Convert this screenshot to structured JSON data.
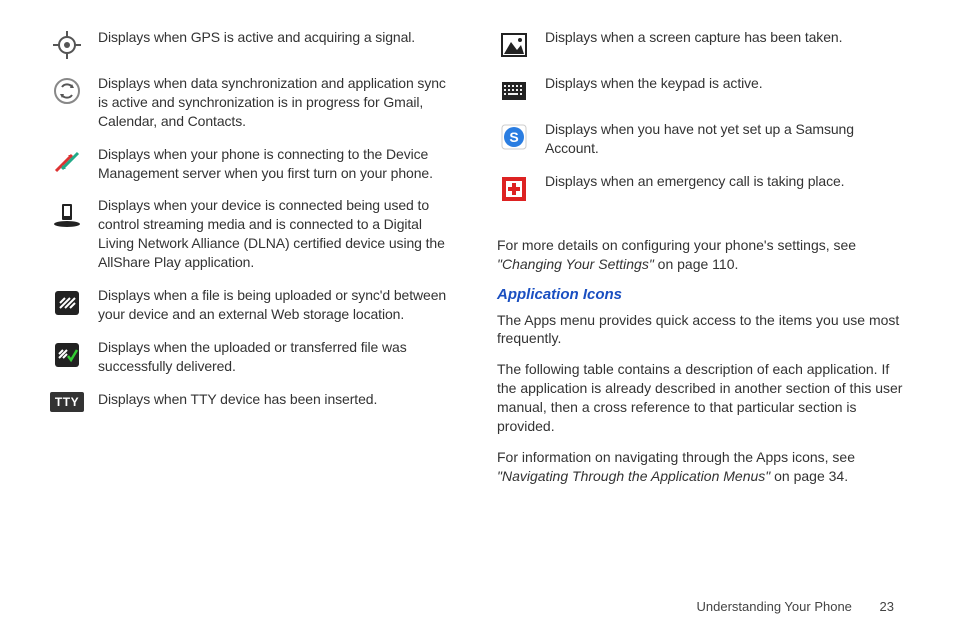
{
  "leftItems": [
    {
      "icon": "gps",
      "text": "Displays when GPS is active and acquiring a signal."
    },
    {
      "icon": "sync",
      "text": "Displays when data synchronization and application sync is active and synchronization is in progress for Gmail, Calendar, and Contacts."
    },
    {
      "icon": "dm",
      "text": "Displays when your phone is connecting to the Device Management server when you first turn on your phone."
    },
    {
      "icon": "dlna",
      "text": "Displays when your device is connected being used to control streaming media and is connected to a Digital Living Network Alliance (DLNA) certified device using the AllShare Play application."
    },
    {
      "icon": "upload",
      "text": "Displays when a file is being uploaded or sync'd between your device and an external Web storage location."
    },
    {
      "icon": "uploadok",
      "text": "Displays when the uploaded or transferred file was successfully delivered."
    },
    {
      "icon": "tty",
      "text": "Displays when TTY device has been inserted."
    }
  ],
  "rightItems": [
    {
      "icon": "capture",
      "text": "Displays when a screen capture has been taken."
    },
    {
      "icon": "keypad",
      "text": "Displays when the keypad is active."
    },
    {
      "icon": "samsung",
      "text": "Displays when you have not yet set up a Samsung Account."
    },
    {
      "icon": "emergency",
      "text": "Displays when an emergency call is taking place."
    }
  ],
  "moreDetails": {
    "prefix": "For more details on configuring your phone's settings, see ",
    "linkText": "\"Changing Your Settings\"",
    "suffix": " on page 110."
  },
  "heading": "Application Icons",
  "p1": "The Apps menu provides quick access to the items you use most frequently.",
  "p2": "The following table contains a description of each application. If the application is already described in another section of this user manual, then a cross reference to that particular section is provided.",
  "navInfo": {
    "prefix": "For information on navigating through the Apps icons, see ",
    "linkText": "\"Navigating Through the Application Menus\"",
    "suffix": " on page 34."
  },
  "footer": {
    "section": "Understanding Your Phone",
    "page": "23"
  },
  "ttyLabel": "TTY"
}
